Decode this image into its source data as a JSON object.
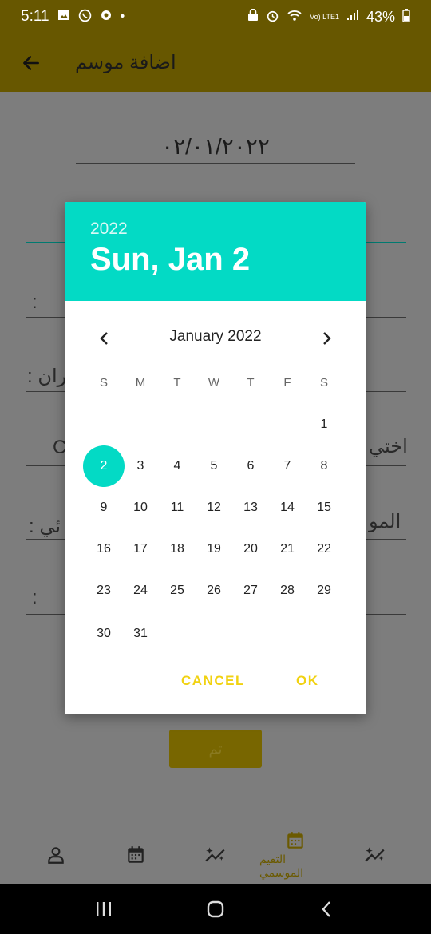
{
  "status": {
    "time": "5:11",
    "battery": "43%",
    "network": "Vo) LTE1"
  },
  "app_bar": {
    "title": "اضافة موسم"
  },
  "form": {
    "date_value": "٠٢/٠١/٢٠٢٢",
    "labels": [
      ":",
      "ران :",
      "اختي",
      "المو",
      "ئي :",
      ":"
    ],
    "field_c": "C",
    "done_label": "تم"
  },
  "bottom_nav": {
    "items": [
      {
        "icon": "person-icon",
        "label": ""
      },
      {
        "icon": "calendar-icon",
        "label": ""
      },
      {
        "icon": "sparkle-trend-icon",
        "label": ""
      },
      {
        "icon": "calendar-active-icon",
        "label": "التقيم الموسمي"
      },
      {
        "icon": "sparkle-trend-icon",
        "label": ""
      }
    ]
  },
  "dialog": {
    "year": "2022",
    "selected_date": "Sun, Jan 2",
    "month_title": "January 2022",
    "weekdays": [
      "S",
      "M",
      "T",
      "W",
      "T",
      "F",
      "S"
    ],
    "days": [
      "1",
      "2",
      "3",
      "4",
      "5",
      "6",
      "7",
      "8",
      "9",
      "10",
      "11",
      "12",
      "13",
      "14",
      "15",
      "16",
      "17",
      "18",
      "19",
      "20",
      "21",
      "22",
      "23",
      "24",
      "25",
      "26",
      "27",
      "28",
      "29",
      "30",
      "31"
    ],
    "first_weekday_index": 6,
    "selected_day": "2",
    "cancel_label": "CANCEL",
    "ok_label": "OK"
  },
  "colors": {
    "app_bar": "#675700",
    "accent": "#03dac5",
    "dialog_button": "#f1d212"
  }
}
